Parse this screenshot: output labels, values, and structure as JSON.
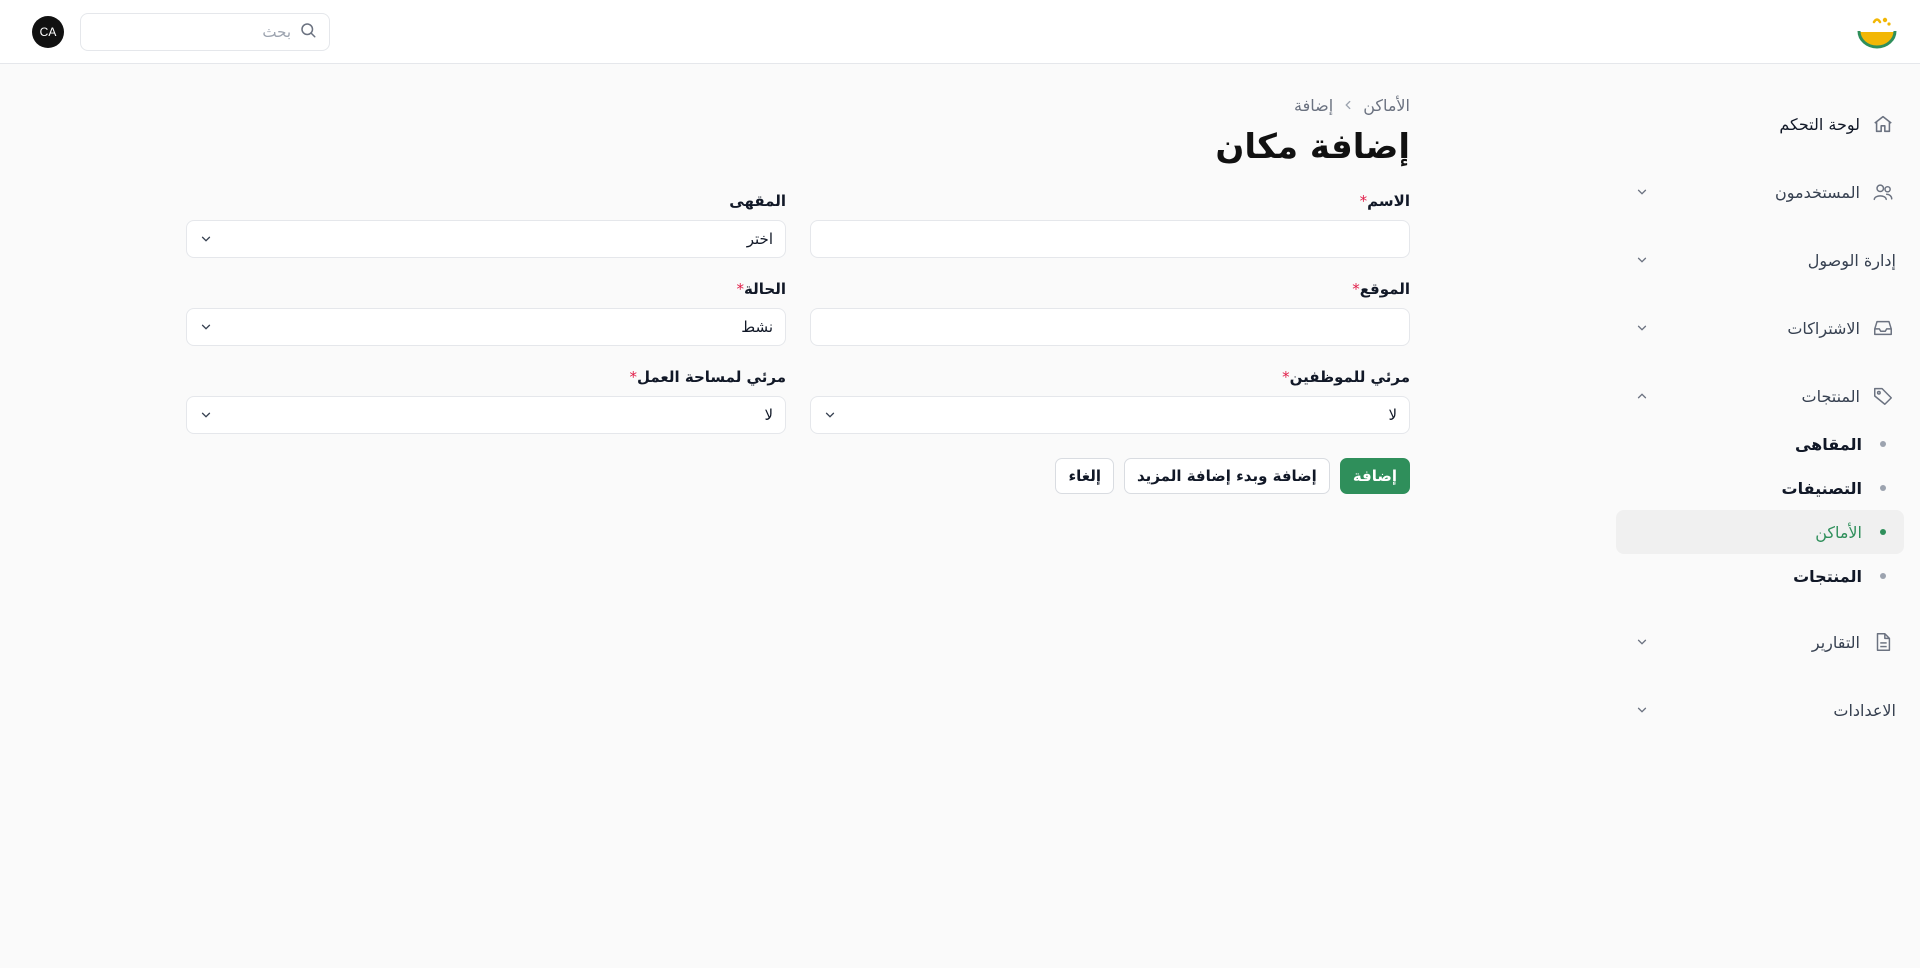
{
  "header": {
    "search": {
      "placeholder": "بحث",
      "value": ""
    },
    "avatar": {
      "initials": "CA"
    },
    "brand_colors": {
      "yellow": "#f2b705",
      "green": "#2f8f5b"
    }
  },
  "sidebar": {
    "items": [
      {
        "label": "لوحة التحكم",
        "icon": "home-icon"
      },
      {
        "label": "المستخدمون",
        "icon": "users-icon",
        "expandable": true
      },
      {
        "label": "إدارة الوصول",
        "expandable": true
      },
      {
        "label": "الاشتراكات",
        "icon": "inbox-icon",
        "expandable": true
      },
      {
        "label": "المنتجات",
        "icon": "tag-icon",
        "expanded": true
      },
      {
        "label": "التقارير",
        "icon": "document-icon",
        "expandable": true
      },
      {
        "label": "الاعدادات",
        "expandable": true
      }
    ],
    "products_sub": [
      {
        "label": "المقاهى"
      },
      {
        "label": "التصنيفات"
      },
      {
        "label": "الأماكن",
        "active": true
      },
      {
        "label": "المنتجات"
      }
    ],
    "active_color": "#2f8f5b"
  },
  "breadcrumb": {
    "parent": "الأماكن",
    "current": "إضافة"
  },
  "page": {
    "title": "إضافة مكان"
  },
  "form": {
    "name": {
      "label": "الاسم",
      "required": "*",
      "value": ""
    },
    "cafe": {
      "label": "المقهى",
      "value": "اختر"
    },
    "location": {
      "label": "الموقع",
      "required": "*",
      "value": ""
    },
    "status": {
      "label": "الحالة",
      "required": "*",
      "value": "نشط"
    },
    "visible_employees": {
      "label": "مرئي للموظفين",
      "required": "*",
      "value": "لا"
    },
    "visible_workspace": {
      "label": "مرئي لمساحة العمل",
      "required": "*",
      "value": "لا"
    }
  },
  "actions": {
    "add": "إضافة",
    "add_and_more": "إضافة وبدء إضافة المزيد",
    "cancel": "إلغاء"
  }
}
